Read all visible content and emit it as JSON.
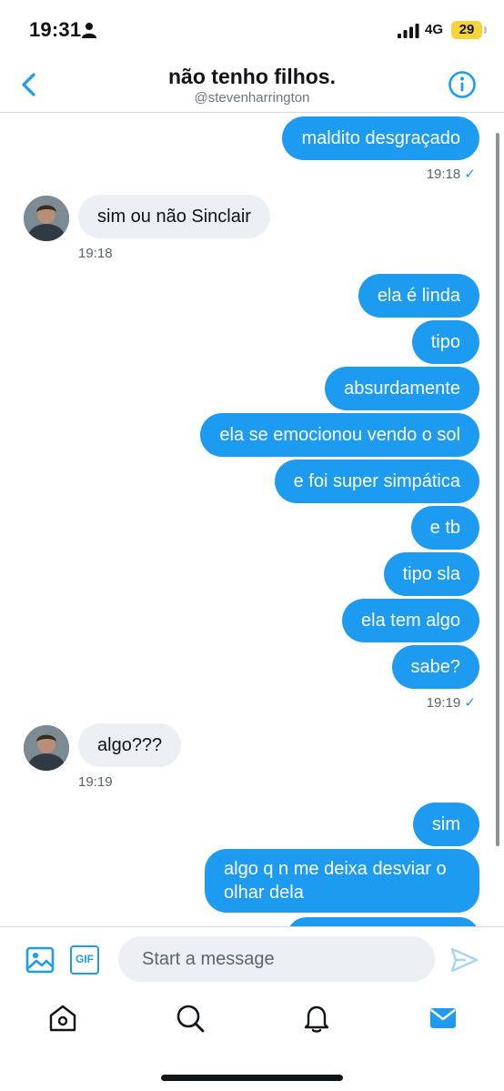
{
  "status_bar": {
    "time": "19:31",
    "network": "4G",
    "battery": "29"
  },
  "header": {
    "title": "não tenho filhos.",
    "handle": "@stevenharrington"
  },
  "messages": [
    {
      "dir": "out",
      "text": "maldito desgraçado"
    },
    {
      "dir": "out_meta",
      "time": "19:18",
      "check": "✓"
    },
    {
      "dir": "in",
      "text": "sim ou não Sinclair"
    },
    {
      "dir": "in_meta",
      "time": "19:18"
    },
    {
      "dir": "out",
      "text": "ela é linda"
    },
    {
      "dir": "out",
      "text": "tipo"
    },
    {
      "dir": "out",
      "text": "absurdamente"
    },
    {
      "dir": "out",
      "text": "ela se emocionou vendo o sol"
    },
    {
      "dir": "out",
      "text": "e foi super simpática"
    },
    {
      "dir": "out",
      "text": "e tb"
    },
    {
      "dir": "out",
      "text": "tipo sla"
    },
    {
      "dir": "out",
      "text": "ela tem algo"
    },
    {
      "dir": "out",
      "text": "sabe?"
    },
    {
      "dir": "out_meta",
      "time": "19:19",
      "check": "✓"
    },
    {
      "dir": "in",
      "text": "algo???"
    },
    {
      "dir": "in_meta",
      "time": "19:19"
    },
    {
      "dir": "out",
      "text": "sim"
    },
    {
      "dir": "out",
      "text": "algo q n me deixa desviar o olhar dela"
    }
  ],
  "composer": {
    "placeholder": "Start a message",
    "gif_label": "GIF"
  },
  "tabs": [
    "home-icon",
    "search-icon",
    "bell-icon",
    "mail-icon"
  ],
  "colors": {
    "accent": "#1d9bf0",
    "incoming_bubble": "#eceff3",
    "muted_text": "#536471"
  }
}
